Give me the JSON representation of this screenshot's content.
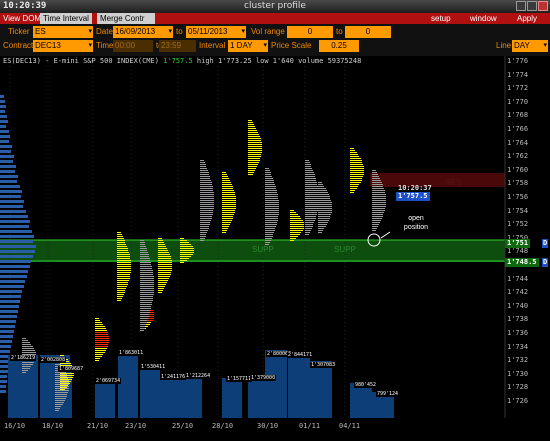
{
  "window": {
    "clock": "10:20:39",
    "title": "cluster profile"
  },
  "menu": {
    "tabs": [
      "View DOM",
      "Time Interval",
      "Merge Contr"
    ],
    "right": [
      "setup",
      "window",
      "Apply"
    ]
  },
  "toolbar": {
    "ticker_label": "Ticker",
    "ticker_value": "ES",
    "date_label": "Date",
    "date_from": "16/09/2013",
    "to_label": "to",
    "date_to": "05/11/2013",
    "vol_range_label": "Vol range",
    "vol_min": "0",
    "vol_to_label": "to",
    "vol_max": "0",
    "contract_label": "Contract",
    "contract_value": "DEC13",
    "time_label": "Time",
    "time_from": "00:00",
    "time_to_label": "to",
    "time_to": "23:59",
    "interval_label": "Interval",
    "interval_value": "1 DAY",
    "price_scale_label": "Price Scale",
    "price_scale_value": "0.25",
    "line_label": "Line",
    "line_value": "DAY"
  },
  "chart_info": {
    "symbol": "ES(DEC13) - E-mini S&P 500 INDEX(CME)",
    "last": "1'757.5",
    "high": "high 1'773.25",
    "low": "low 1'640",
    "volume": "volume 59375248"
  },
  "price_axis": [
    "1'776",
    "1'774",
    "1'772",
    "1'770",
    "1'768",
    "1'766",
    "1'764",
    "1'762",
    "1'760",
    "1'758",
    "1'756",
    "1'754",
    "1'752",
    "1'750",
    "1'748",
    "1'746",
    "1'744",
    "1'742",
    "1'740",
    "1'738",
    "1'736",
    "1'734",
    "1'732",
    "1'730",
    "1'728",
    "1'726"
  ],
  "date_axis": [
    "16/10",
    "18/10",
    "21/10",
    "23/10",
    "25/10",
    "28/10",
    "30/10",
    "01/11",
    "04/11"
  ],
  "tags": {
    "current_time": "10:20:37",
    "current_price": "1'757.5",
    "supp_upper_price": "1'751",
    "supp_lower_price": "1'748.5",
    "supp_flag": "D",
    "resistance_label": "RES",
    "supp_label": "SUPP"
  },
  "annotation": {
    "line1": "open",
    "line2": "position"
  },
  "volume_labels": [
    "2'186219",
    "2'002808",
    "1'809687",
    "2'069734",
    "1'863011",
    "1'530411",
    "1'241176",
    "1'212264",
    "1'157711",
    "1'379000",
    "2'800060",
    "2'844171",
    "1'307083",
    "980'452",
    "799'124",
    "1'452001"
  ],
  "colors": {
    "accent": "#ff9a00",
    "menu_bar": "#b01010",
    "supp_zone": "#0d4d0d",
    "res_zone": "#4a0808",
    "profile_yellow": "#ffff00",
    "profile_red": "#ff2a00",
    "current_price_tag": "#1e50c8"
  }
}
